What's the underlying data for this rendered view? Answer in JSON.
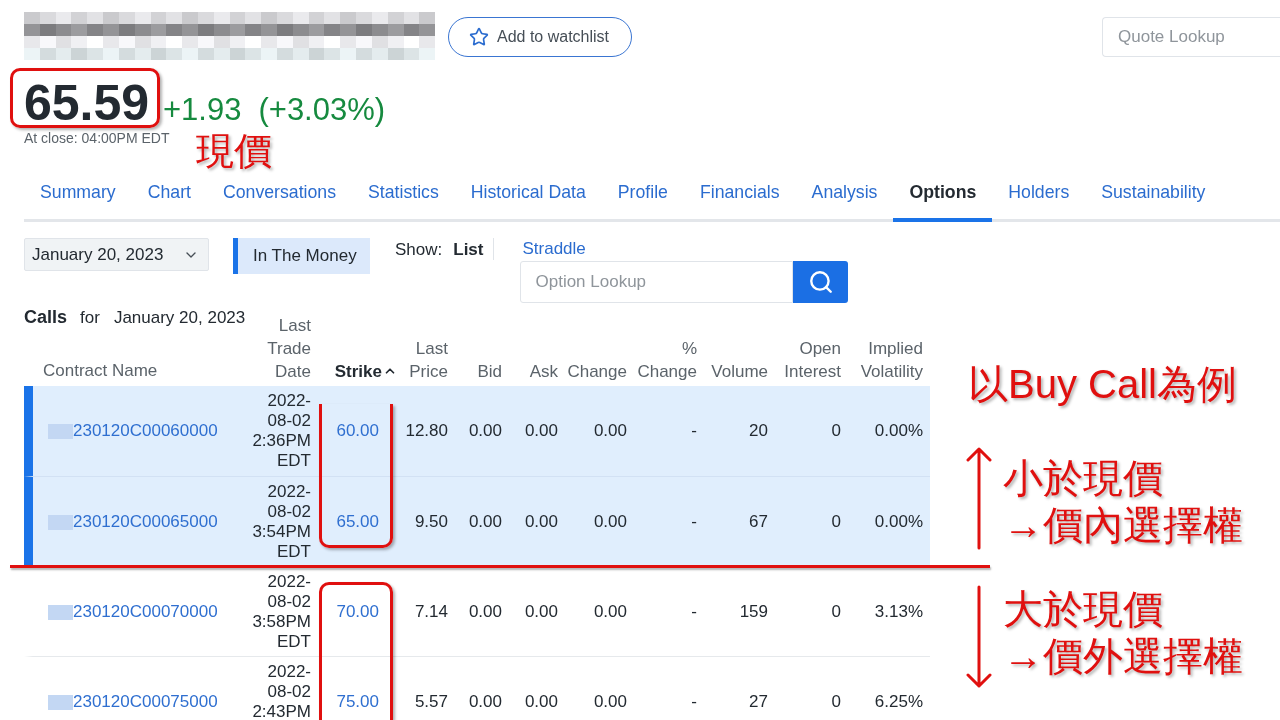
{
  "watchlist_button": {
    "label": "Add to watchlist"
  },
  "quote_search": {
    "placeholder": "Quote Lookup"
  },
  "quote": {
    "price": "65.59",
    "change": "+1.93",
    "change_percent": "(+3.03%)",
    "market_time": "At close: 04:00PM EDT"
  },
  "tabs": [
    {
      "label": "Summary",
      "selected": false
    },
    {
      "label": "Chart",
      "selected": false
    },
    {
      "label": "Conversations",
      "selected": false
    },
    {
      "label": "Statistics",
      "selected": false
    },
    {
      "label": "Historical Data",
      "selected": false
    },
    {
      "label": "Profile",
      "selected": false
    },
    {
      "label": "Financials",
      "selected": false
    },
    {
      "label": "Analysis",
      "selected": false
    },
    {
      "label": "Options",
      "selected": true
    },
    {
      "label": "Holders",
      "selected": false
    },
    {
      "label": "Sustainability",
      "selected": false
    }
  ],
  "options_controls": {
    "expiration": "January 20, 2023",
    "in_the_money_toggle": {
      "label": "In The Money",
      "on": true
    },
    "show_label": "Show:",
    "view_options": [
      {
        "label": "List",
        "selected": true
      },
      {
        "label": "Straddle",
        "selected": false
      }
    ],
    "option_search": {
      "placeholder": "Option Lookup"
    }
  },
  "calls_table": {
    "title": "Calls",
    "for_label": "for",
    "date": "January 20, 2023",
    "columns": [
      {
        "label": "Contract Name",
        "sorted": false
      },
      {
        "label": "Last Trade Date",
        "sorted": false
      },
      {
        "label": "Strike",
        "sorted": true
      },
      {
        "label": "Last Price",
        "sorted": false
      },
      {
        "label": "Bid",
        "sorted": false
      },
      {
        "label": "Ask",
        "sorted": false
      },
      {
        "label": "Change",
        "sorted": false
      },
      {
        "label": "% Change",
        "sorted": false
      },
      {
        "label": "Volume",
        "sorted": false
      },
      {
        "label": "Open Interest",
        "sorted": false
      },
      {
        "label": "Implied Volatility",
        "sorted": false
      }
    ],
    "rows": [
      {
        "contract": "230120C00060000",
        "last_trade_date": "2022-08-02 2:36PM EDT",
        "strike": "60.00",
        "last_price": "12.80",
        "bid": "0.00",
        "ask": "0.00",
        "change": "0.00",
        "percent_change": "-",
        "volume": "20",
        "open_interest": "0",
        "implied_volatility": "0.00%",
        "in_the_money": true
      },
      {
        "contract": "230120C00065000",
        "last_trade_date": "2022-08-02 3:54PM EDT",
        "strike": "65.00",
        "last_price": "9.50",
        "bid": "0.00",
        "ask": "0.00",
        "change": "0.00",
        "percent_change": "-",
        "volume": "67",
        "open_interest": "0",
        "implied_volatility": "0.00%",
        "in_the_money": true
      },
      {
        "contract": "230120C00070000",
        "last_trade_date": "2022-08-02 3:58PM EDT",
        "strike": "70.00",
        "last_price": "7.14",
        "bid": "0.00",
        "ask": "0.00",
        "change": "0.00",
        "percent_change": "-",
        "volume": "159",
        "open_interest": "0",
        "implied_volatility": "3.13%",
        "in_the_money": false
      },
      {
        "contract": "230120C00075000",
        "last_trade_date": "2022-08-02 2:43PM",
        "strike": "75.00",
        "last_price": "5.57",
        "bid": "0.00",
        "ask": "0.00",
        "change": "0.00",
        "percent_change": "-",
        "volume": "27",
        "open_interest": "0",
        "implied_volatility": "6.25%",
        "in_the_money": false
      }
    ]
  },
  "annotations": {
    "price_label": "現價",
    "example_caption": "以Buy Call為例",
    "below_price_note": [
      "小於現價",
      "→價內選擇權"
    ],
    "above_price_note": [
      "大於現價",
      "→價外選擇權"
    ]
  }
}
